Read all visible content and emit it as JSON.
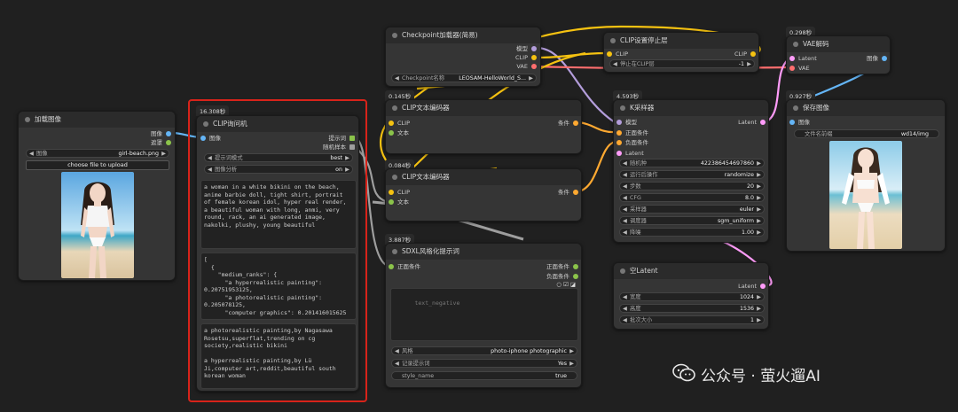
{
  "colors": {
    "background": "#202020",
    "node_bg": "#353535",
    "title_bg": "#2b2b2b",
    "highlight_border": "#d8231a",
    "wire_model": "#b39ddb",
    "wire_clip": "#f5c211",
    "wire_vae": "#ff6e6e",
    "wire_conditioning": "#ffa931",
    "wire_latent": "#ff9cf9",
    "wire_image": "#64b5f6",
    "wire_string": "#8bc34a",
    "wire_gray": "#9e9e9e"
  },
  "load_image": {
    "title": "加载图像",
    "out_image": "图像",
    "out_mask": "遮罩",
    "image_label": "图像",
    "image_value": "girl-beach.png",
    "upload_button": "choose file to upload"
  },
  "clip_interrogator": {
    "timing": "16.308秒",
    "title": "CLIP询问机",
    "in_image": "图像",
    "out_prompt": "提示词",
    "out_random": "随机样本",
    "mode_label": "提示词模式",
    "mode_value": "best",
    "analysis_label": "图像分析",
    "analysis_value": "on",
    "prompt_text": "a woman in a white bikini on the beach, anime barbie doll, tight shirt, portrait of female korean idol, hyper real render, a beautiful woman with long, anmi, very round, rack, an ai generated image, nakolki, plushy, young beautiful",
    "ranks_text": "[\n  {\n    \"medium_ranks\": {\n      \"a hyperrealistic painting\": 0.20751953125,\n      \"a photorealistic painting\": 0.205078125,\n      \"computer graphics\": 0.201416015625",
    "samples_text": "a photorealistic painting,by Nagasawa Rosetsu,superflat,trending on cg society,realistic bikini\n\na hyperrealistic painting,by Lü Ji,computer art,reddit,beautiful south korean woman\n\na hyperrealistic painting,by Lü"
  },
  "checkpoint_loader": {
    "title": "Checkpoint加载器(简易)",
    "out_model": "模型",
    "out_clip": "CLIP",
    "out_vae": "VAE",
    "ckpt_label": "Checkpoint名称",
    "ckpt_value": "LEOSAM-HelloWorld_S..."
  },
  "clip_set_last_layer": {
    "title": "CLIP设置停止层",
    "in_clip": "CLIP",
    "out_clip": "CLIP",
    "layer_label": "停止在CLIP层",
    "layer_value": "-1"
  },
  "vae_decode": {
    "timing": "0.298秒",
    "title": "VAE解码",
    "in_latent": "Latent",
    "in_vae": "VAE",
    "out_image": "图像"
  },
  "clip_text_encode_1": {
    "timing": "0.145秒",
    "title": "CLIP文本编码器",
    "in_clip": "CLIP",
    "in_text": "文本",
    "out_cond": "条件"
  },
  "clip_text_encode_2": {
    "timing": "0.084秒",
    "title": "CLIP文本编码器",
    "in_clip": "CLIP",
    "in_text": "文本",
    "out_cond": "条件"
  },
  "ksampler": {
    "timing": "4.593秒",
    "title": "K采样器",
    "in_model": "模型",
    "in_positive": "正面条件",
    "in_negative": "负面条件",
    "in_latent": "Latent",
    "out_latent": "Latent",
    "seed_label": "随机种",
    "seed_value": "422386454697860",
    "control_label": "运行后操作",
    "control_value": "randomize",
    "steps_label": "步数",
    "steps_value": "20",
    "cfg_label": "CFG",
    "cfg_value": "8.0",
    "sampler_label": "采样器",
    "sampler_value": "euler",
    "scheduler_label": "调度器",
    "scheduler_value": "sgm_uniform",
    "denoise_label": "降噪",
    "denoise_value": "1.00"
  },
  "save_image": {
    "timing": "0.927秒",
    "title": "保存图像",
    "in_image": "图像",
    "prefix_label": "文件名前缀",
    "prefix_value": "wd14/img"
  },
  "sdxl_styler": {
    "timing": "3.887秒",
    "title": "SDXL风格化提示词",
    "in_positive": "正面条件",
    "out_positive": "正面条件",
    "out_negative": "负面条件",
    "negative_placeholder": "text_negative",
    "style_label": "风格",
    "style_value": "photo-iphone photographic",
    "log_label": "记录提示词",
    "log_value": "Yes",
    "style_name_label": "style_name",
    "style_name_value": "true"
  },
  "empty_latent": {
    "title": "空Latent",
    "out_latent": "Latent",
    "width_label": "宽度",
    "width_value": "1024",
    "height_label": "高度",
    "height_value": "1536",
    "batch_label": "批次大小",
    "batch_value": "1"
  },
  "watermark": {
    "text": "公众号 · 萤火遛AI"
  }
}
